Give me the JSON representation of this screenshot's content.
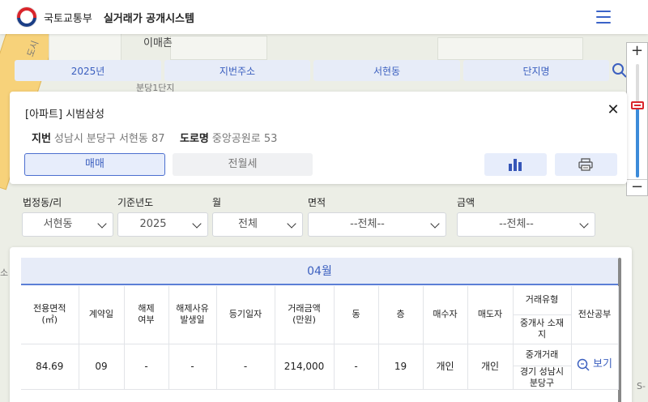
{
  "header": {
    "ministry": "국토교통부",
    "system": "실거래가 공개시스템"
  },
  "map": {
    "labels": [
      "이매촌",
      "도시",
      "분당1단지",
      "소",
      "S-"
    ]
  },
  "filters": [
    "2025년",
    "지번주소",
    "서현동",
    "단지명"
  ],
  "card": {
    "title": "[아파트] 시범삼성",
    "jibun_label": "지번",
    "jibun_value": "성남시 분당구 서현동 87",
    "road_label": "도로명",
    "road_value": "중앙공원로 53",
    "tab_sale": "매매",
    "tab_rent": "전월세"
  },
  "selectors": {
    "dong_label": "법정동/리",
    "dong_value": "서현동",
    "year_label": "기준년도",
    "year_value": "2025",
    "month_label": "월",
    "month_value": "전체",
    "area_label": "면적",
    "area_value": "--전체--",
    "price_label": "금액",
    "price_value": "--전체--"
  },
  "table": {
    "month_title": "04월",
    "headers": {
      "area": "전용면적\n(㎡)",
      "date": "계약일",
      "cancel": "해제\n여부",
      "cancel_date": "해제사유\n발생일",
      "reg_date": "등기일자",
      "price": "거래금액\n(만원)",
      "dong": "동",
      "floor": "층",
      "buyer": "매수자",
      "seller": "매도자",
      "deal_type": "거래유형",
      "agent_loc": "중개사 소재\n지",
      "ledger": "전산공부"
    },
    "rows": [
      {
        "area": "84.69",
        "date": "09",
        "cancel": "-",
        "cancel_date": "-",
        "reg_date": "-",
        "price": "214,000",
        "dong": "-",
        "floor": "19",
        "buyer": "개인",
        "seller": "개인",
        "deal_type": "중개거래",
        "agent_loc": "경기 성남시\n분당구",
        "ledger": "보기"
      }
    ]
  },
  "zoom": {
    "plus": "+",
    "minus": "−"
  },
  "colors": {
    "accent": "#3b5fbf",
    "accent_bg": "#e7edfb",
    "flag_red": "#d9252b",
    "flag_blue": "#1b3e86"
  }
}
